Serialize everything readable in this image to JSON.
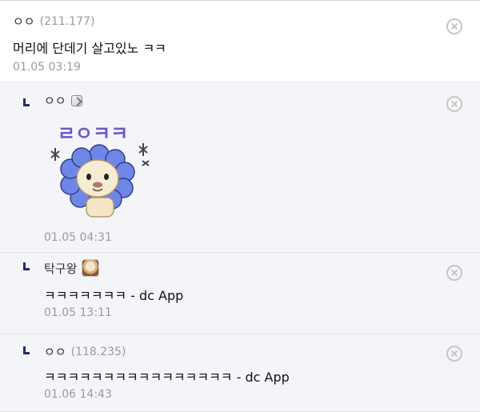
{
  "comments": [
    {
      "nickname": "ㅇㅇ",
      "ip": "(211.177)",
      "text": "머리에 단데기 살고있노 ㅋㅋ",
      "date": "01.05 03:19"
    },
    {
      "nickname": "ㅇㅇ",
      "sticker_label": "ㄹㅇㅋㅋ",
      "date": "01.05 04:31"
    },
    {
      "nickname": "탁구왕",
      "text": "ㅋㅋㅋㅋㅋㅋㅋ - dc App",
      "date": "01.05 13:11"
    },
    {
      "nickname": "ㅇㅇ",
      "ip": "(118.235)",
      "text": "ㅋㅋㅋㅋㅋㅋㅋㅋㅋㅋㅋㅋㅋㅋㅋㅋ - dc App",
      "date": "01.06 14:43"
    }
  ],
  "colors": {
    "reply_bg": "#f4f5f8",
    "reply_mark": "#1f2e72",
    "meta_text": "#9a9a9a",
    "sticker_purple": "#6a59c8",
    "sticker_petal": "#6f86e6"
  },
  "icons": {
    "delete": "close-circle-icon",
    "reply": "reply-arrow-icon",
    "fixed_nick": "fixed-nick-badge-icon"
  }
}
